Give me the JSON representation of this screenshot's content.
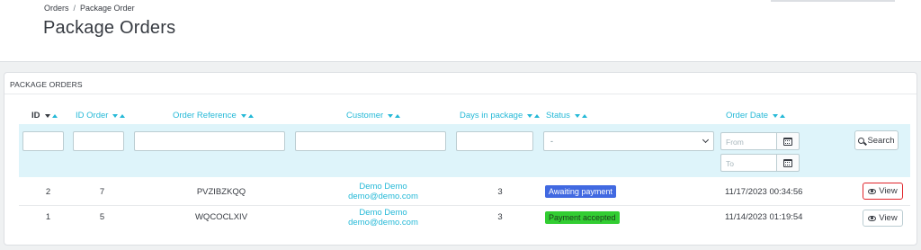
{
  "breadcrumb": {
    "parent": "Orders",
    "separator": "/",
    "current": "Package Order"
  },
  "page": {
    "title": "Package Orders"
  },
  "panel": {
    "title": "PACKAGE ORDERS"
  },
  "columns": {
    "id": "ID",
    "id_order": "ID Order",
    "order_reference": "Order Reference",
    "customer": "Customer",
    "days_in_package": "Days in package",
    "status": "Status",
    "order_date": "Order Date"
  },
  "filters": {
    "status_selected": "-",
    "date_from_placeholder": "From",
    "date_to_placeholder": "To",
    "search_label": "Search"
  },
  "rows": [
    {
      "id": "2",
      "id_order": "7",
      "reference": "PVZIBZKQQ",
      "customer_name": "Demo Demo",
      "customer_email": "demo@demo.com",
      "days": "3",
      "status": "Awaiting payment",
      "status_color": "#4169e1",
      "date": "11/17/2023 00:34:56",
      "action": "View"
    },
    {
      "id": "1",
      "id_order": "5",
      "reference": "WQCOCLXIV",
      "customer_name": "Demo Demo",
      "customer_email": "demo@demo.com",
      "days": "3",
      "status": "Payment accepted",
      "status_color": "#32cd32",
      "date": "11/14/2023 01:19:54",
      "action": "View"
    }
  ],
  "colors": {
    "accent": "#25b9d7",
    "filter_band": "#def4fa",
    "highlight": "#e0252b"
  }
}
